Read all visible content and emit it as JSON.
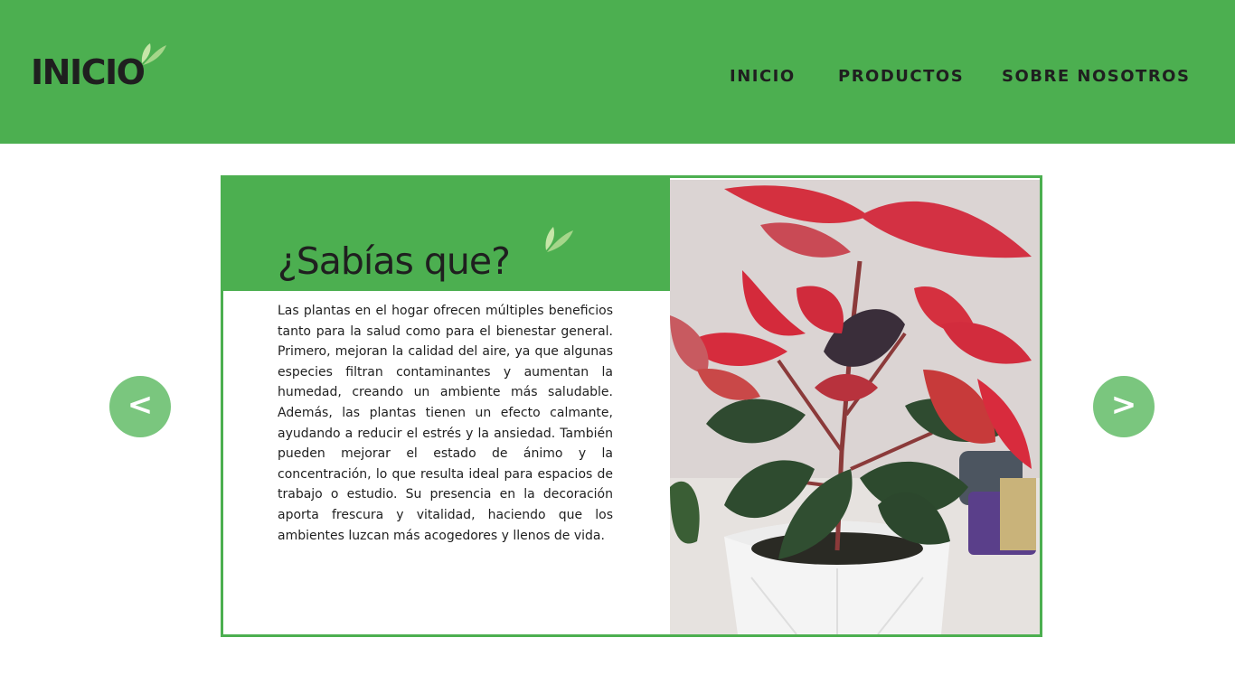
{
  "header": {
    "logo_text": "INICIO",
    "nav": [
      {
        "label": "INICIO"
      },
      {
        "label": "PRODUCTOS"
      },
      {
        "label": "SOBRE NOSOTROS"
      }
    ]
  },
  "slide": {
    "title": "¿Sabías que?",
    "body": "Las plantas en el hogar ofrecen múltiples beneficios tanto para la salud como para el bienestar general. Primero, mejoran la calidad del aire, ya que algunas especies filtran contaminantes y aumentan la humedad, creando un ambiente más saludable. Además, las plantas tienen un efecto calmante, ayudando a reducir el estrés y la ansiedad. También pueden mejorar el estado de ánimo y la concentración, lo que resulta ideal para espacios de trabajo o estudio. Su presencia en la decoración aporta frescura y vitalidad, haciendo que los ambientes luzcan más acogedores y llenos de vida."
  },
  "carousel": {
    "prev_label": "<",
    "next_label": ">"
  },
  "icons": {
    "logo_leaf": "leaf-icon",
    "title_leaf": "leaf-icon"
  },
  "colors": {
    "brand_green": "#4caf50",
    "arrow_green": "#7ac67e",
    "leaf_light": "#a5d68a",
    "text_dark": "#1f1f1f"
  }
}
